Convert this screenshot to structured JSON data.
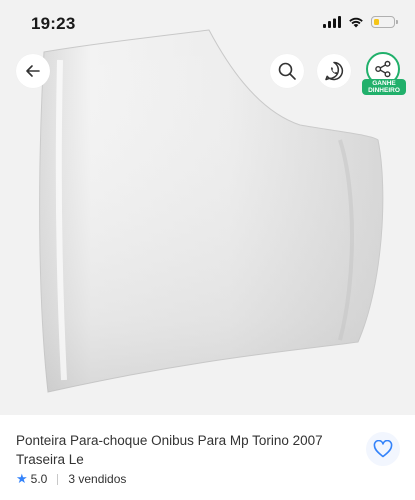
{
  "status_bar": {
    "time": "19:23",
    "battery_level": 0.3,
    "battery_color": "#f5c518",
    "icons": [
      "signal-icon",
      "wifi-icon",
      "battery-icon"
    ]
  },
  "header": {
    "back_icon": "back-arrow-icon",
    "search_icon": "search-icon",
    "whatsapp_icon": "whatsapp-icon",
    "share_icon": "share-icon",
    "earn_badge_line1": "GANHE",
    "earn_badge_line2": "DINHEIRO",
    "earn_color": "#21b06b"
  },
  "product": {
    "title": "Ponteira Para-choque Onibus Para Mp Torino 2007 Traseira Le",
    "rating": "5.0",
    "sold": "3 vendidos",
    "star_color": "#3483fa",
    "favorite_icon": "heart-icon"
  }
}
